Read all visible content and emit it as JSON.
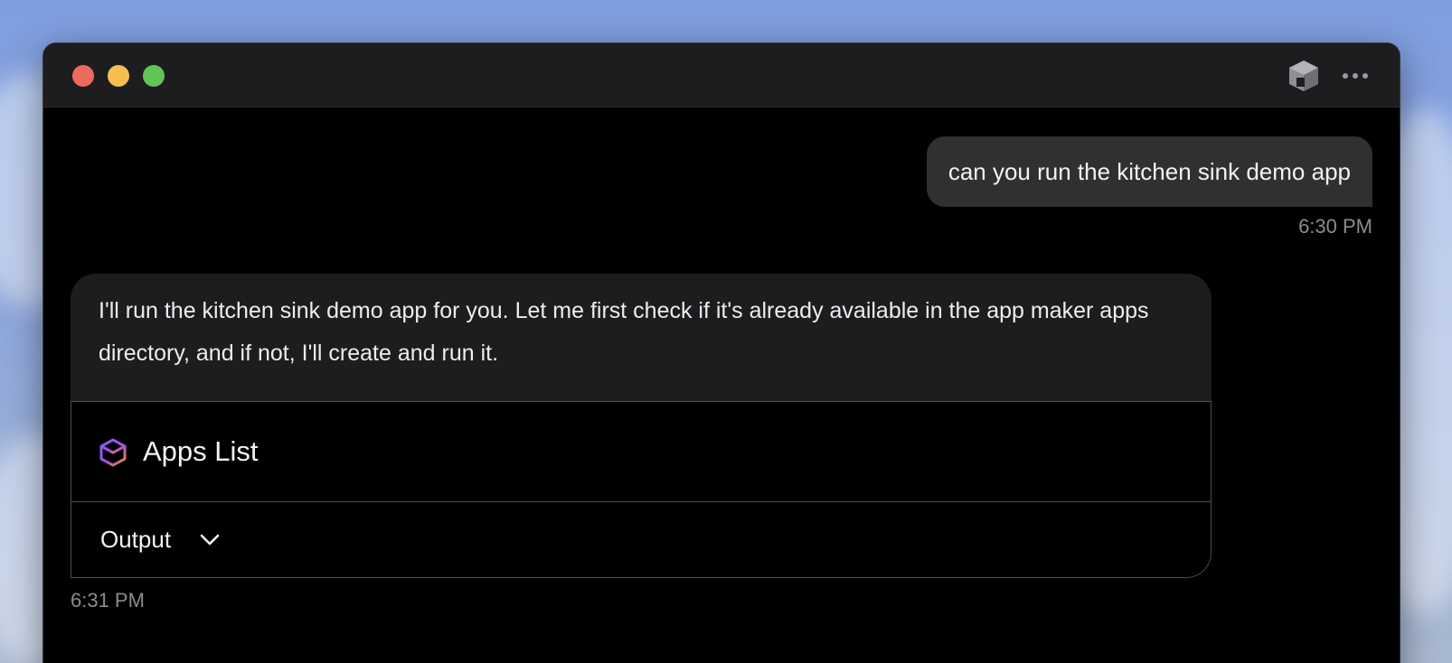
{
  "window": {
    "controls": [
      "close",
      "minimize",
      "maximize"
    ],
    "toolbar_icons": [
      "cube-icon",
      "more-icon"
    ]
  },
  "chat": {
    "user_message": {
      "text": "can you run the kitchen sink demo app",
      "time": "6:30 PM"
    },
    "assistant_message": {
      "text": "I'll run the kitchen sink demo app for you. Let me first check if it's already available in the app maker apps directory, and if not, I'll create and run it.",
      "tool": {
        "icon": "cube-icon",
        "title": "Apps List",
        "output_label": "Output",
        "output_toggle_icon": "chevron-down-icon"
      },
      "time": "6:31 PM"
    }
  },
  "colors": {
    "window_bg": "#000000",
    "titlebar_bg": "#1d1d1f",
    "user_bubble_bg": "#303032",
    "assistant_bubble_bg": "#1d1d1f",
    "tool_border": "#4a4f5c",
    "timestamp": "#8b8b90"
  }
}
